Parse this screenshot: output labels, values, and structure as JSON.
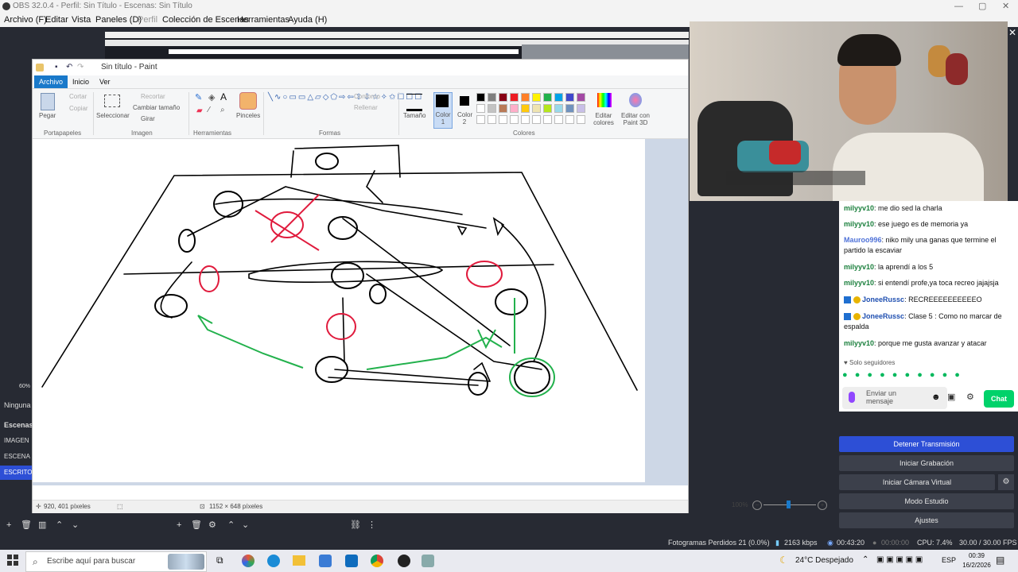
{
  "obs": {
    "title": "OBS 32.0.4 - Perfil: Sin Título - Escenas: Sin Título",
    "menu": [
      "Archivo (F)",
      "Editar",
      "Vista",
      "Paneles (D)",
      "Perfil",
      "Colección de Escenas",
      "Herramientas",
      "Ayuda (H)"
    ],
    "left_labels": {
      "zoom": "60%",
      "ninguna": "Ninguna",
      "escenas": "Escenas",
      "scene1": "IMAGEN",
      "scene2": "ESCENA",
      "scene3": "ESCRITO"
    },
    "controls": [
      "Detener Transmisión",
      "Iniciar Grabación",
      "Iniciar Cámara Virtual",
      "Modo Estudio",
      "Ajustes"
    ],
    "status": {
      "dropped": "Fotogramas Perdidos 21 (0.0%)",
      "bitrate": "2163 kbps",
      "stream_time": "00:43:20",
      "rec_time": "00:00:00",
      "cpu": "CPU: 7.4%",
      "fps": "30.00 / 30.00 FPS"
    }
  },
  "paint": {
    "title": "Sin título - Paint",
    "tabs": [
      "Archivo",
      "Inicio",
      "Ver"
    ],
    "clipboard": {
      "paste": "Pegar",
      "cut": "Cortar",
      "copy": "Copiar",
      "group": "Portapapeles"
    },
    "image": {
      "select": "Seleccionar",
      "crop": "Recortar",
      "resize": "Cambiar tamaño",
      "rotate": "Girar",
      "group": "Imagen"
    },
    "tools": {
      "group": "Herramientas",
      "brushes": "Pinceles"
    },
    "shapes": {
      "outline": "Contorno",
      "fill": "Rellenar",
      "group": "Formas"
    },
    "size": "Tamaño",
    "color1": "Color 1",
    "color2": "Color 2",
    "colors_group": "Colores",
    "edit_colors": "Editar colores",
    "paint3d": "Editar con Paint 3D",
    "palette": [
      "#000000",
      "#7f7f7f",
      "#880015",
      "#ed1c24",
      "#ff7f27",
      "#fff200",
      "#22b14c",
      "#00a2e8",
      "#3f48cc",
      "#a349a4",
      "#ffffff",
      "#c3c3c3",
      "#b97a57",
      "#ffaec9",
      "#ffc90e",
      "#efe4b0",
      "#b5e61d",
      "#99d9ea",
      "#7092be",
      "#c8bfe7"
    ],
    "status": {
      "pos": "920, 401 píxeles",
      "size": "1152 × 648 píxeles",
      "zoom": "100%"
    }
  },
  "chat": {
    "messages": [
      {
        "user": "milyyv10",
        "text": "me dio sed la charla"
      },
      {
        "user": "milyyv10",
        "text": "ese juego es de memoria ya"
      },
      {
        "user": "Mauroo996",
        "text": "niko mily una ganas que termine el partido la escaviar"
      },
      {
        "user": "milyyv10",
        "text": "la aprendí a los 5"
      },
      {
        "user": "milyyv10",
        "text": "si entendí profe,ya toca recreo jajajsja"
      },
      {
        "user": "JoneeRussc",
        "text": "RECREEEEEEEEEEO"
      },
      {
        "user": "JoneeRussc",
        "text": "Clase 5 : Como no marcar de espalda"
      },
      {
        "user": "milyyv10",
        "text": "porque me gusta avanzar y atacar"
      }
    ],
    "followers_only": "Solo seguidores",
    "input_placeholder": "Enviar un mensaje",
    "chat_button": "Chat"
  },
  "taskbar": {
    "search_placeholder": "Escribe aquí para buscar",
    "weather": "24°C  Despejado",
    "lang": "ESP",
    "time": "00:39",
    "date": "16/2/2026"
  },
  "colors": {
    "paint_accent": "#1979ca",
    "obs_bg": "#272a33",
    "obs_button": "#3c404b",
    "stop_stream": "#2d4fd6",
    "chat_green": "#00d26a"
  }
}
